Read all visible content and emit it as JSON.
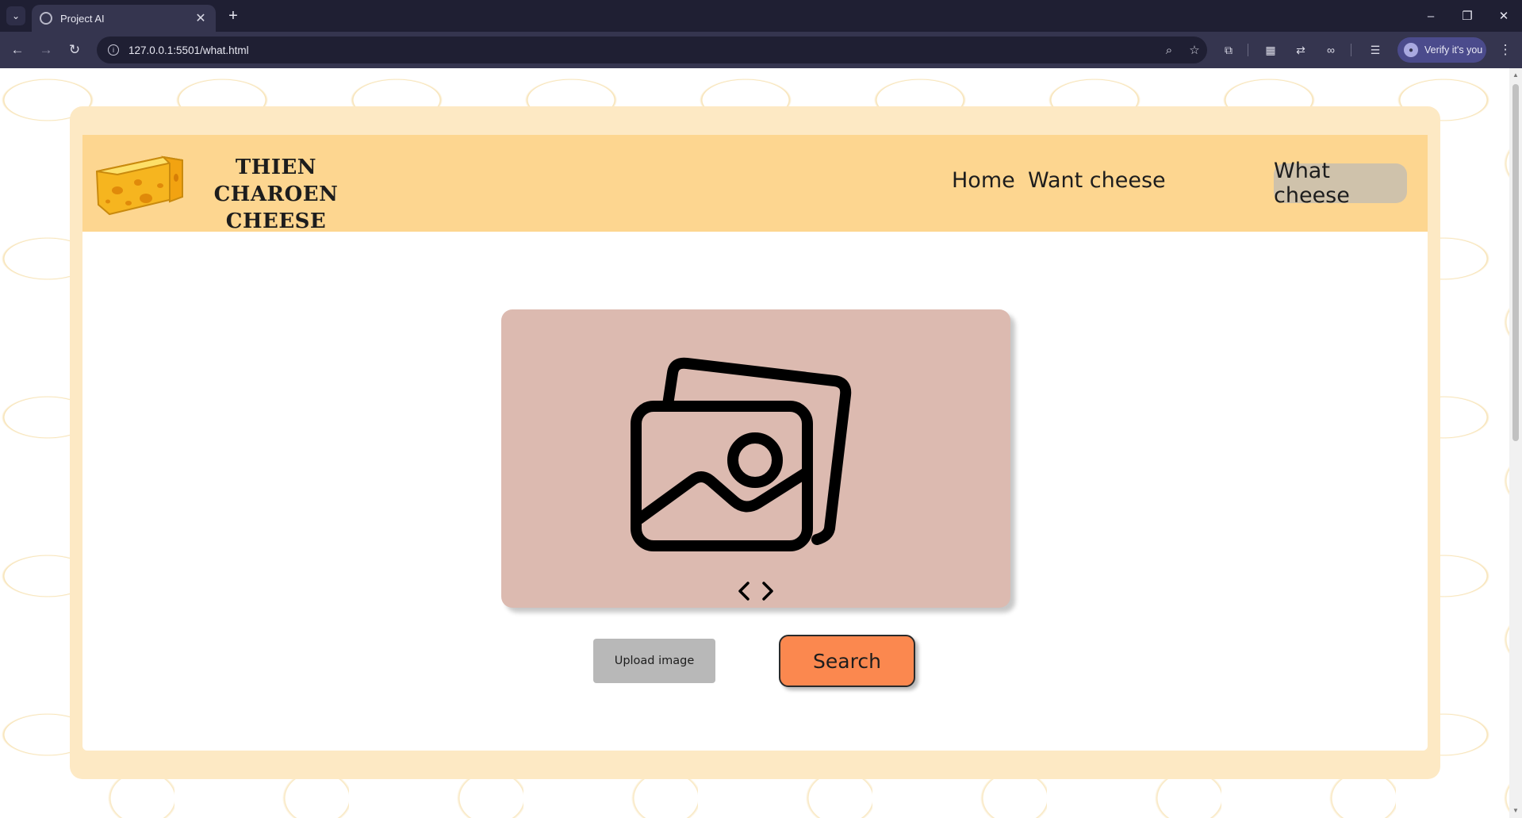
{
  "browser": {
    "tab_title": "Project AI",
    "url": "127.0.0.1:5501/what.html",
    "verify_label": "Verify it's you"
  },
  "site": {
    "brand_line1": "THIEN CHAROEN",
    "brand_line2": "CHEESE",
    "nav": {
      "home": "Home",
      "want": "Want cheese",
      "what": "What cheese"
    }
  },
  "main": {
    "upload_label": "Upload image",
    "search_label": "Search"
  },
  "colors": {
    "frame": "#fde9c4",
    "navbar": "#fdd690",
    "active_nav": "#cfc2ab",
    "preview_bg": "#dcbab0",
    "search_button": "#fb884f",
    "upload_button": "#b8b8b8"
  }
}
